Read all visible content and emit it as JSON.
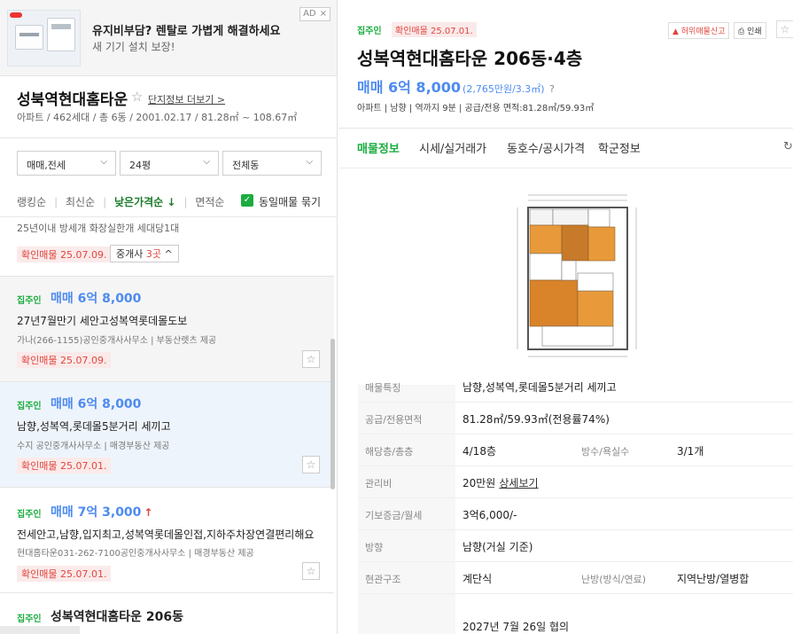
{
  "ad": {
    "title": "유지비부담? 렌탈로 가볍게 해결하세요",
    "subtitle": "새 기기 설치 보장!",
    "badge": "AD",
    "close": "×"
  },
  "complex": {
    "name": "성북역현대홈타운",
    "more_link": "단지정보 더보기 >",
    "info": "아파트 / 462세대 / 총 6동 / 2001.02.17 / 81.28㎡ ~ 108.67㎡"
  },
  "filters": {
    "trade": "매매,전세",
    "size": "24평",
    "dong": "전체동"
  },
  "sort": {
    "items": [
      "랭킹순",
      "최신순",
      "낮은가격순 ↓",
      "면적순"
    ],
    "same_listing": "동일매물 묶기"
  },
  "prev_item": {
    "tags": "25년이내  방세개  화장실한개  세대당1대",
    "confirm": "확인매물 25.07.09.",
    "agents_prefix": "중개사 ",
    "agents_count": "3곳",
    "agents_suffix": " ^"
  },
  "listings": [
    {
      "badge": "집주인",
      "price": "매매 6억 8,000",
      "up": "",
      "desc": "27년7월만기 세안고성복역롯데몰도보",
      "agent": "가나(266-1155)공인중개사사무소 | 부동산렛츠 제공",
      "confirm": "확인매물 25.07.09."
    },
    {
      "badge": "집주인",
      "price": "매매 6억 8,000",
      "up": "",
      "desc": "남향,성복역,롯데몰5분거리 세끼고",
      "agent": "수지 공인중개사사무소 | 매경부동산 제공",
      "confirm": "확인매물 25.07.01."
    },
    {
      "badge": "집주인",
      "price": "매매 7억 3,000",
      "up": "↑",
      "desc": "전세안고,남향,입지최고,성복역롯데몰인접,지하주차장연결편리해요",
      "agent": "현대홈타운031-262-7100공인중개사사무소 | 매경부동산 제공",
      "confirm": "확인매물 25.07.01."
    },
    {
      "badge": "집주인",
      "price": "성복역현대홈타운 206동",
      "up": "",
      "desc": "",
      "agent": "",
      "confirm": ""
    }
  ],
  "detail": {
    "badge": "집주인",
    "confirm": "확인매물 25.07.01.",
    "report": "허위매물신고",
    "print": "인쇄",
    "title": "성복역현대홈타운 206동·4층",
    "price": "매매 6억 8,000",
    "price_unit": "(2,765만원/3.3㎡)",
    "price_q": "?",
    "meta": "아파트 | 남향 | 역까지 9분 | 공급/전용 면적:81.28㎡/59.93㎡",
    "tabs": [
      "매물정보",
      "시세/실거래가",
      "동호수/공시가격",
      "학군정보"
    ],
    "rows": [
      {
        "k": "매물특징",
        "v": "남향,성복역,롯데몰5분거리 세끼고",
        "k2": "",
        "v2": "",
        "link": ""
      },
      {
        "k": "공급/전용면적",
        "v": "81.28㎡/59.93㎡(전용률74%)",
        "k2": "",
        "v2": "",
        "link": ""
      },
      {
        "k": "해당층/총층",
        "v": "4/18층",
        "k2": "방수/욕실수",
        "v2": "3/1개",
        "link": ""
      },
      {
        "k": "관리비",
        "v": "20만원",
        "k2": "",
        "v2": "",
        "link": "상세보기"
      },
      {
        "k": "기보증금/월세",
        "v": "3억6,000/-",
        "k2": "",
        "v2": "",
        "link": ""
      },
      {
        "k": "방향",
        "v": "남향(거실 기준)",
        "k2": "",
        "v2": "",
        "link": ""
      },
      {
        "k": "현관구조",
        "v": "계단식",
        "k2": "난방(방식/연료)",
        "v2": "지역난방/열병합",
        "link": ""
      },
      {
        "k": "",
        "v": "2027년 7월 26일 협의",
        "k2": "",
        "v2": "",
        "link": ""
      }
    ]
  },
  "colors": {
    "green": "#1aad3f",
    "blue_price": "#4e8bf0",
    "red_confirm": "#e0463d"
  }
}
